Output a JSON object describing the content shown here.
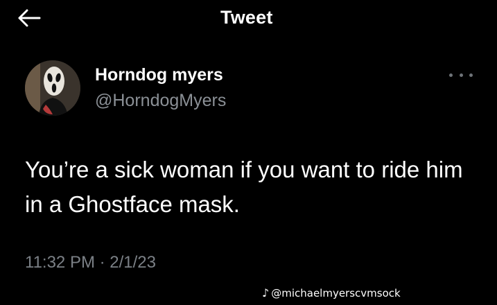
{
  "header": {
    "title": "Tweet",
    "back_icon": "arrow-left-icon"
  },
  "tweet": {
    "author": {
      "display_name": "Horndog myers",
      "handle": "@HorndogMyers",
      "avatar": "ghostface-mask-avatar"
    },
    "more_icon": "more-horizontal-icon",
    "text": "You’re a sick woman if you want to ride him in a Ghostface mask.",
    "timestamp": "11:32 PM · 2/1/23"
  },
  "watermark": {
    "icon": "tiktok-icon",
    "text": "@michaelmyerscvmsock"
  },
  "colors": {
    "background": "#000000",
    "primary_text": "#ffffff",
    "secondary_text": "#8b9096"
  }
}
